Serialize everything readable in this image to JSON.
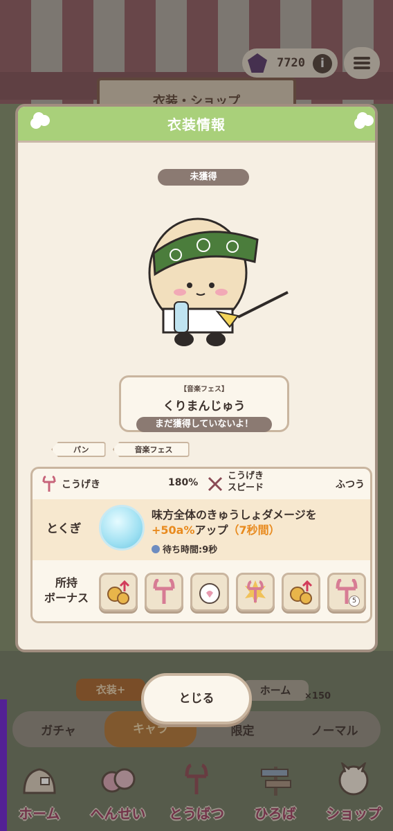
{
  "hud": {
    "gem_icon": "gem-icon",
    "gems": "7720",
    "info_label": "i",
    "menu_icon": "menu-icon"
  },
  "background": {
    "sign_text": "衣装・ショップ",
    "costume_plus": "衣装+",
    "home_button": "ホーム",
    "price": "×150",
    "tabs": [
      "ガチャ",
      "キャラ",
      "限定",
      "ノーマル"
    ]
  },
  "modal": {
    "title": "衣装情報",
    "status": "未獲得",
    "name_tag": "【音楽フェス】",
    "name": "くりまんじゅう",
    "note": "まだ獲得していないよ！",
    "tags": [
      "パン",
      "音楽フェス"
    ],
    "stats": {
      "attack_label": "こうげき",
      "attack_value": "180%",
      "speed_label_1": "こうげき",
      "speed_label_2": "スピード",
      "speed_value": "ふつう"
    },
    "skill": {
      "label": "とくぎ",
      "desc_1": "味方全体のきゅうしょダメージを",
      "desc_2_highlight": "+50a%",
      "desc_2_mid": "アップ",
      "desc_2_paren": "（7秒間）",
      "wait": "待ち時間:9秒"
    },
    "bonus": {
      "label_1": "所持",
      "label_2": "ボーナス",
      "items": [
        "coin-up-icon",
        "trident-icon",
        "cat-face-icon",
        "trident-burst-icon",
        "coin-up-icon",
        "trident-icon"
      ],
      "last_badge": "5"
    },
    "close": "とじる"
  },
  "nav": {
    "items": [
      "ホーム",
      "へんせい",
      "とうばつ",
      "ひろば",
      "ショップ"
    ]
  },
  "colors": {
    "header_green": "#a9d07a",
    "panel": "#f6efe3",
    "border": "#c9b59f",
    "accent_orange": "#e88a1e",
    "nav_pink": "#9c3e63"
  }
}
